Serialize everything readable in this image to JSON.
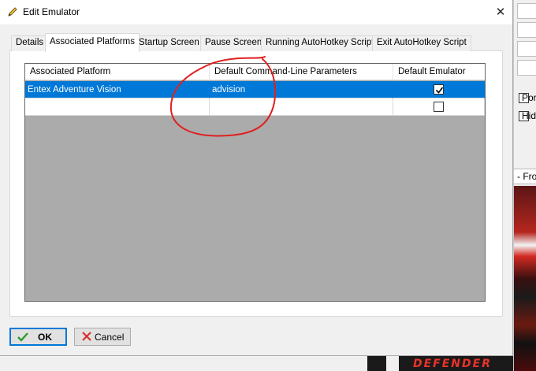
{
  "window": {
    "title": "Edit Emulator",
    "close_glyph": "✕"
  },
  "tabs": [
    {
      "label": "Details"
    },
    {
      "label": "Associated Platforms",
      "active": true
    },
    {
      "label": "Startup Screen"
    },
    {
      "label": "Pause Screen"
    },
    {
      "label": "Running AutoHotkey Script"
    },
    {
      "label": "Exit AutoHotkey Script"
    }
  ],
  "grid": {
    "columns": [
      "Associated Platform",
      "Default Command-Line Parameters",
      "Default Emulator"
    ],
    "rows": [
      {
        "platform": "Entex Adventure Vision",
        "params": "advision",
        "default": true,
        "selected": true
      },
      {
        "platform": "",
        "params": "",
        "default": false,
        "selected": false
      }
    ]
  },
  "buttons": {
    "ok": "OK",
    "cancel": "Cancel"
  },
  "background_app": {
    "labels": [
      "Port",
      "Hide"
    ],
    "front_label": "- Fron",
    "art_text": "DEFENDER"
  },
  "colors": {
    "selection": "#0078d7",
    "grid_empty": "#ababab",
    "annotation": "#e02020"
  },
  "icons": {
    "title": "pencil-icon",
    "ok": "checkmark-icon",
    "cancel": "x-icon",
    "close": "close-icon"
  }
}
